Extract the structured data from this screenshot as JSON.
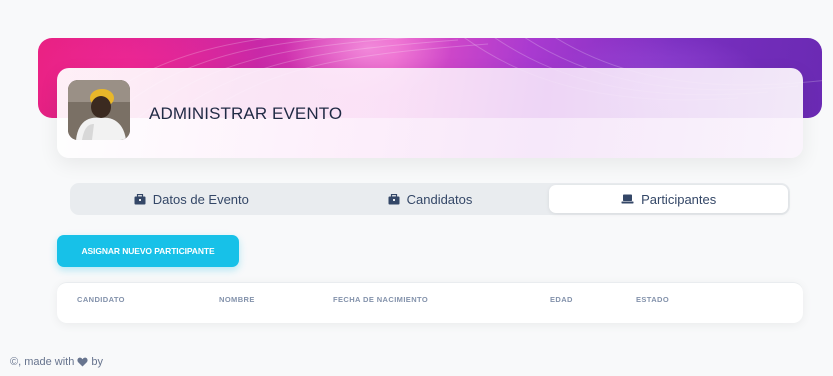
{
  "header": {
    "title": "ADMINISTRAR EVENTO",
    "avatar_icon": "user-avatar"
  },
  "tabs": [
    {
      "label": "Datos de Evento",
      "icon": "briefcase-icon",
      "active": false
    },
    {
      "label": "Candidatos",
      "icon": "briefcase-icon",
      "active": false
    },
    {
      "label": "Participantes",
      "icon": "laptop-icon",
      "active": true
    }
  ],
  "actions": {
    "assign_label": "ASIGNAR NUEVO PARTICIPANTE"
  },
  "table": {
    "columns": [
      "CANDIDATO",
      "NOMBRE",
      "FECHA DE NACIMIENTO",
      "EDAD",
      "ESTADO"
    ],
    "rows": []
  },
  "footer": {
    "prefix": "©, made with",
    "suffix": "by",
    "icon": "heart-icon"
  },
  "colors": {
    "accent": "#17c1e8",
    "banner_start": "#e6207f",
    "banner_end": "#6a2ab3",
    "text": "#344767"
  }
}
